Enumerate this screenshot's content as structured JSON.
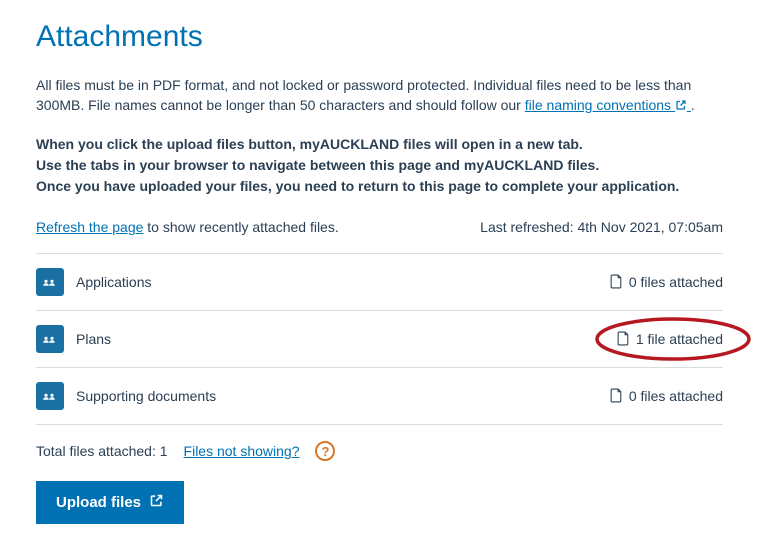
{
  "heading": "Attachments",
  "intro_text": "All files must be in PDF format, and not locked or password protected. Individual files need to be less than 300MB. File names cannot be longer than 50 characters and should follow our ",
  "intro_link": "file naming conventions",
  "bold_line1": "When you click the upload files button, myAUCKLAND files will open in a new tab.",
  "bold_line2": "Use the tabs in your browser to navigate between this page and myAUCKLAND files.",
  "bold_line3": "Once you have uploaded your files, you need to return to this page to complete your application.",
  "refresh_link": "Refresh the page",
  "refresh_tail": " to show recently attached files.",
  "last_refreshed": "Last refreshed: 4th Nov 2021, 07:05am",
  "categories": [
    {
      "label": "Applications",
      "count_text": "0 files attached"
    },
    {
      "label": "Plans",
      "count_text": "1 file attached"
    },
    {
      "label": "Supporting documents",
      "count_text": "0 files attached"
    }
  ],
  "total_label": "Total files attached: 1",
  "files_not_showing": "Files not showing?",
  "upload_label": "Upload files"
}
